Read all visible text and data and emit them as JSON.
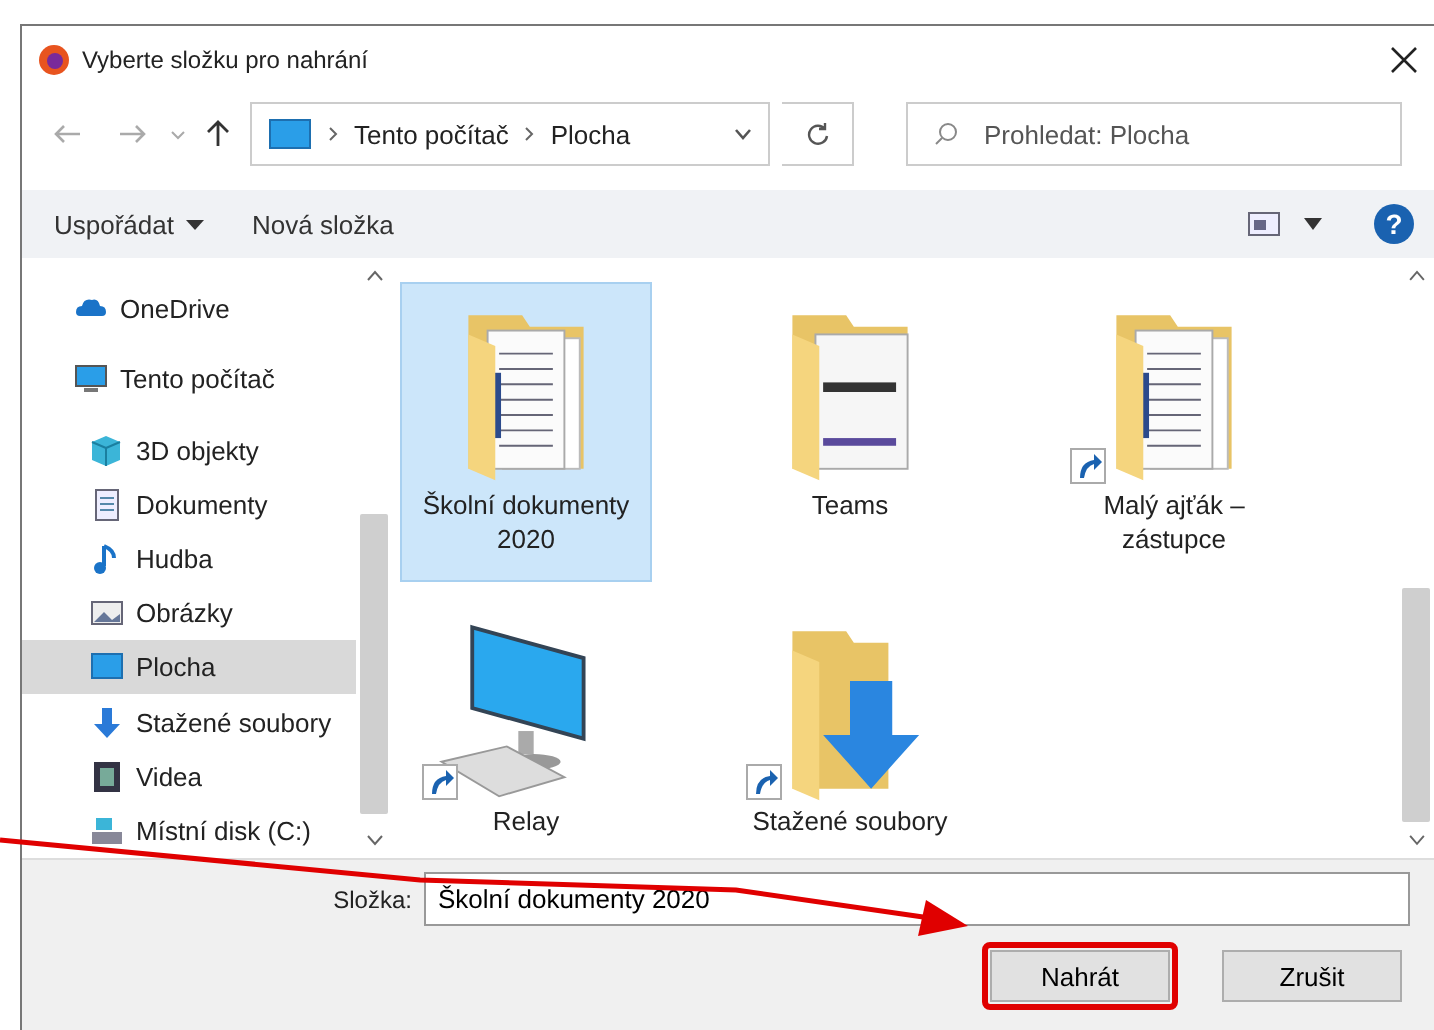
{
  "window": {
    "title": "Vyberte složku pro nahrání"
  },
  "address_bar": {
    "crumbs": [
      "Tento počítač",
      "Plocha"
    ]
  },
  "search": {
    "placeholder": "Prohledat: Plocha"
  },
  "toolbar": {
    "organize": "Uspořádat",
    "new_folder": "Nová složka",
    "help": "?"
  },
  "sidebar": {
    "items": [
      {
        "label": "OneDrive",
        "kind": "cloud",
        "selected": false
      },
      {
        "label": "Tento počítač",
        "kind": "pc",
        "selected": false,
        "children": [
          {
            "label": "3D objekty",
            "kind": "cube",
            "selected": false
          },
          {
            "label": "Dokumenty",
            "kind": "doc",
            "selected": false
          },
          {
            "label": "Hudba",
            "kind": "music",
            "selected": false
          },
          {
            "label": "Obrázky",
            "kind": "picture",
            "selected": false
          },
          {
            "label": "Plocha",
            "kind": "desktop",
            "selected": true
          },
          {
            "label": "Stažené soubory",
            "kind": "download",
            "selected": false
          },
          {
            "label": "Videa",
            "kind": "video",
            "selected": false
          },
          {
            "label": "Místní disk (C:)",
            "kind": "disk",
            "selected": false
          }
        ]
      }
    ]
  },
  "files": [
    {
      "name": "Školní dokumenty 2020",
      "kind": "docs-folder",
      "shortcut": false,
      "selected": true
    },
    {
      "name": "Teams",
      "kind": "pages-folder",
      "shortcut": false,
      "selected": false
    },
    {
      "name": "Malý ajťák – zástupce",
      "kind": "docs-folder",
      "shortcut": true,
      "selected": false
    },
    {
      "name": "Relay",
      "kind": "computer",
      "shortcut": true,
      "selected": false
    },
    {
      "name": "Stažené soubory",
      "kind": "download-folder",
      "shortcut": true,
      "selected": false
    }
  ],
  "folder_field": {
    "label": "Složka:",
    "value": "Školní dokumenty 2020"
  },
  "buttons": [
    {
      "label": "Nahrát",
      "highlighted": true
    },
    {
      "label": "Zrušit",
      "highlighted": false
    }
  ],
  "callout_arrow": true
}
